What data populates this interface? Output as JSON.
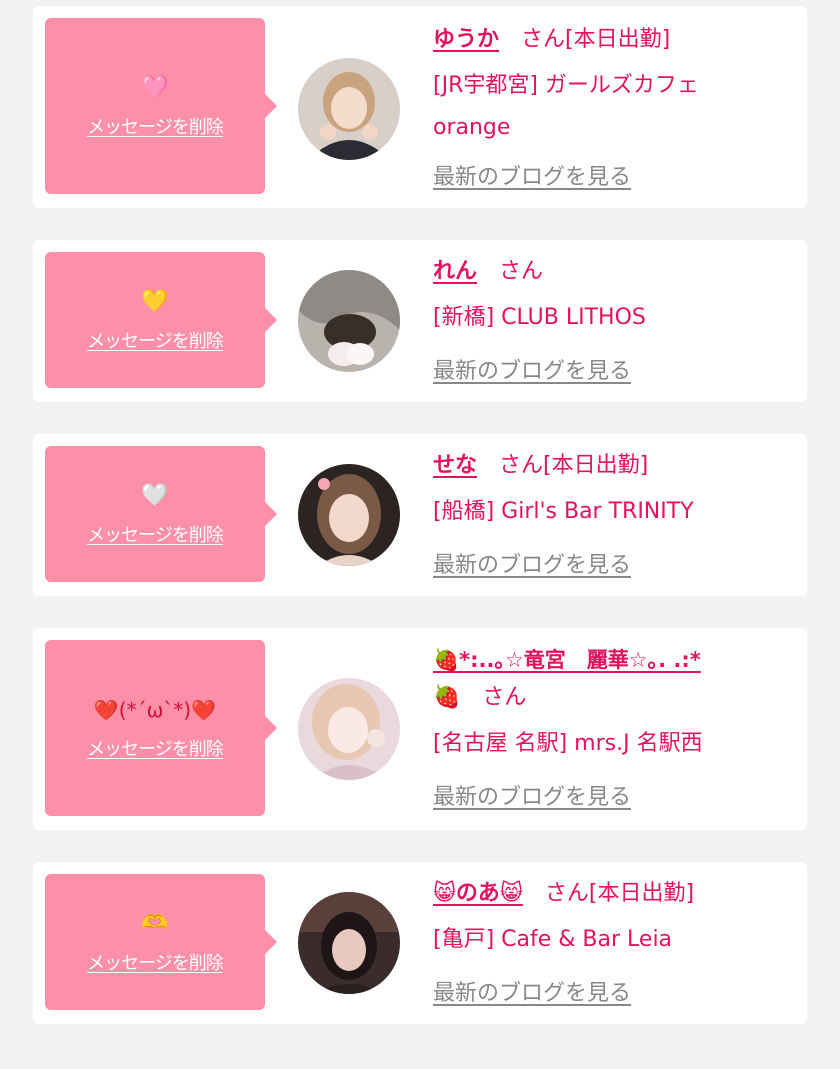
{
  "colors": {
    "page_bg": "#f2f2f2",
    "card_bg": "#ffffff",
    "bubble_bg": "#fe8fa8",
    "accent": "#e2135c",
    "link_gray": "#888888"
  },
  "messages": [
    {
      "emoji": "🩷",
      "delete_label": "メッセージを削除",
      "name": "ゆうか",
      "suffix": "さん[本日出勤]",
      "shop_line1": "[JR宇都宮] ガールズカフェ",
      "shop_line2": "orange",
      "blog_label": "最新のブログを見る",
      "avatar_icon": "girl-avatar"
    },
    {
      "emoji": "💛",
      "delete_label": "メッセージを削除",
      "name": "れん",
      "suffix": "さん",
      "shop_line1": "[新橋] CLUB LITHOS",
      "blog_label": "最新のブログを見る",
      "avatar_icon": "girl-avatar"
    },
    {
      "emoji": "🤍",
      "delete_label": "メッセージを削除",
      "name": "せな",
      "suffix": "さん[本日出勤]",
      "shop_line1": "[船橋] Girl's Bar TRINITY",
      "blog_label": "最新のブログを見る",
      "avatar_icon": "girl-avatar"
    },
    {
      "emoji": "❤️(*´ω`*)❤️",
      "delete_label": "メッセージを削除",
      "name": "🍓*:..｡☆竜宮　麗華☆｡. .:*",
      "name_line2": "🍓",
      "suffix": "さん",
      "shop_line1": "[名古屋 名駅] mrs.J 名駅西",
      "blog_label": "最新のブログを見る",
      "avatar_icon": "girl-avatar"
    },
    {
      "emoji": "🫶",
      "delete_label": "メッセージを削除",
      "name": "😸のあ😸",
      "suffix": "さん[本日出勤]",
      "shop_line1": "[亀戸] Cafe & Bar Leia",
      "blog_label": "最新のブログを見る",
      "avatar_icon": "girl-avatar"
    }
  ]
}
